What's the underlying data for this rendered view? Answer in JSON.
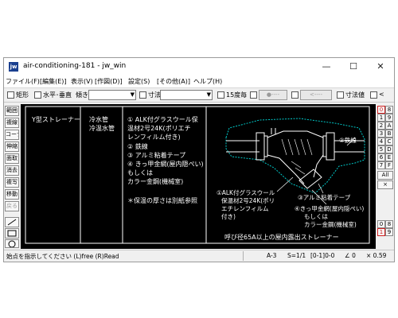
{
  "window": {
    "title": "air-conditioning-181 - jw_win",
    "app_icon_text": "jw",
    "controls": {
      "minimize": "—",
      "maximize": "☐",
      "close": "✕"
    }
  },
  "menu": [
    "ファイル(F)",
    "[編集(E)]",
    "表示(V)",
    "[作図(D)]",
    "設定(S)",
    "[その他(A)]",
    "ヘルプ(H)"
  ],
  "toolbar": {
    "rect_label": "矩形",
    "hv_label": "水平･垂直",
    "slope_label": "傾き",
    "dimension_label": "寸法",
    "deg15_label": "15度毎",
    "pill1": "●----",
    "pill2": "<----",
    "dim_value_label": "寸法値",
    "lt_label": "<"
  },
  "left_tools": [
    "範囲",
    "複線",
    "コーナー",
    "伸縮",
    "面取",
    "消去",
    "複写",
    "移動",
    "戻る"
  ],
  "right_tools": {
    "top": [
      "0",
      "8",
      "1",
      "9",
      "2",
      "A",
      "3",
      "B",
      "4",
      "C",
      "5",
      "D",
      "6",
      "E",
      "7",
      "F"
    ],
    "all_label": "All",
    "x_label": "×",
    "bottom": [
      "0",
      "8",
      "1",
      "9"
    ]
  },
  "drawing": {
    "col1": "Y型ストレーナー",
    "col2_line1": "冷水管",
    "col2_line2": "冷温水管",
    "spec": [
      "① ALK付グラスウール保",
      "   温材2号24K(ポリエチ",
      "   レンフィルム付き)",
      "② 鉄線",
      "③ アルミ粘着テープ",
      "④ きっ甲金網(屋内隠ぺい)",
      "   もしくは",
      "   カラー金鋼(機械室)"
    ],
    "note": "＊保温の厚さは別紙参照",
    "callout_2": "②鉄線",
    "callout_1": [
      "①ALK付グラスウール",
      "保温材2号24K(ポリ",
      "エチレンフィルム",
      "付き)"
    ],
    "callout_3": "③アルミ粘着テープ",
    "callout_4": [
      "④きっ甲金網(屋内隠ぺい)",
      "もしくは",
      "カラー金鋼(機械室)"
    ],
    "caption": "呼び径65A以上の屋内露出ストレーナー"
  },
  "status": {
    "message": "始点を指示してください (L)free (R)Read",
    "paper": "A-3",
    "scale": "S=1/1",
    "layer": "[0-1]0-0",
    "angle": "∠ 0",
    "zoom": "× 0.59"
  },
  "colors": {
    "canvas_bg": "#000000",
    "drawing_text": "#ffffff",
    "active_layer": "#d02020",
    "insulation": "#00c8c8"
  }
}
